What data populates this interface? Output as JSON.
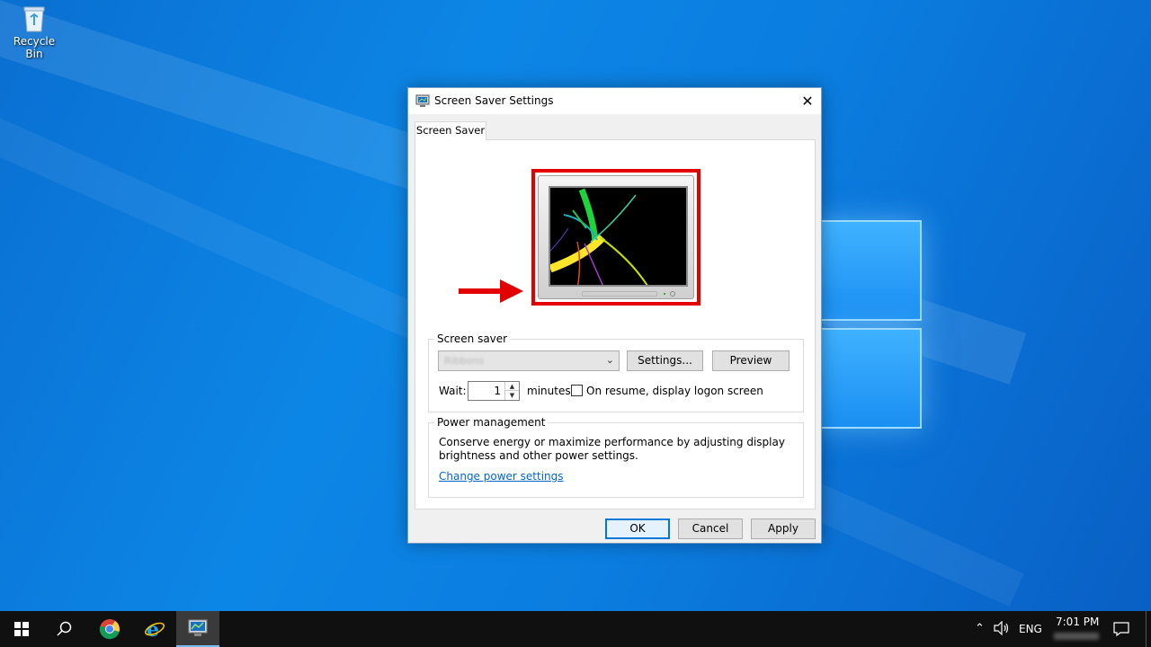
{
  "desktop": {
    "recycle_bin_label": "Recycle Bin"
  },
  "dialog": {
    "title": "Screen Saver Settings",
    "close_glyph": "✕",
    "tab_label": "Screen Saver",
    "screen_saver_group": {
      "label": "Screen saver",
      "selected_value": "Ribbons",
      "settings_button": "Settings...",
      "preview_button": "Preview",
      "wait_label": "Wait:",
      "wait_value": "1",
      "minutes_label": "minutes",
      "logon_checkbox_label": "On resume, display logon screen",
      "logon_checked": false
    },
    "power_group": {
      "label": "Power management",
      "description_line1": "Conserve energy or maximize performance by adjusting display",
      "description_line2": "brightness and other power settings.",
      "link": "Change power settings"
    },
    "buttons": {
      "ok": "OK",
      "cancel": "Cancel",
      "apply": "Apply"
    }
  },
  "taskbar": {
    "icons": [
      "start-icon",
      "search-icon",
      "chrome-icon",
      "internet-explorer-icon",
      "screen-saver-settings-icon"
    ],
    "tray": {
      "language": "ENG",
      "time": "7:01 PM"
    }
  },
  "colors": {
    "desktop_blue": "#0a78d6",
    "highlight_red": "#e30000",
    "link_blue": "#0066cc",
    "accent": "#0078d7"
  }
}
